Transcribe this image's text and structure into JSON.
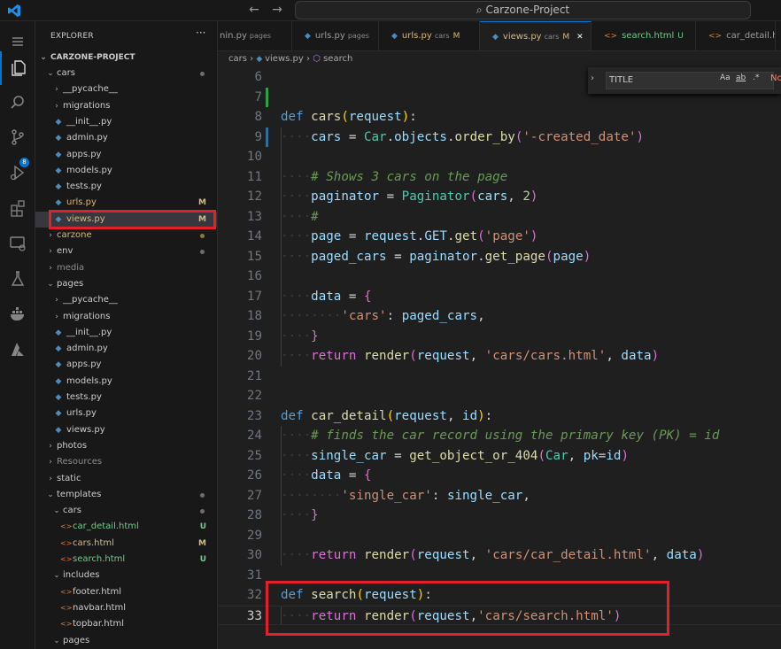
{
  "window": {
    "search_text": "Carzone-Project"
  },
  "explorer": {
    "title": "EXPLORER",
    "project": "CARZONE-PROJECT",
    "items": [
      {
        "label": "cars",
        "type": "folder",
        "open": true,
        "depth": 1,
        "dot": true
      },
      {
        "label": "__pycache__",
        "type": "folder",
        "open": false,
        "depth": 2
      },
      {
        "label": "migrations",
        "type": "folder",
        "open": false,
        "depth": 2
      },
      {
        "label": "__init__.py",
        "type": "py",
        "depth": 2
      },
      {
        "label": "admin.py",
        "type": "py",
        "depth": 2
      },
      {
        "label": "apps.py",
        "type": "py",
        "depth": 2
      },
      {
        "label": "models.py",
        "type": "py",
        "depth": 2
      },
      {
        "label": "tests.py",
        "type": "py",
        "depth": 2
      },
      {
        "label": "urls.py",
        "type": "py",
        "depth": 2,
        "status": "M"
      },
      {
        "label": "views.py",
        "type": "py",
        "depth": 2,
        "status": "M",
        "selected": true
      },
      {
        "label": "carzone",
        "type": "folder",
        "open": false,
        "depth": 1,
        "dot": true,
        "color": "mod"
      },
      {
        "label": "env",
        "type": "folder",
        "open": false,
        "depth": 1,
        "dot": true
      },
      {
        "label": "media",
        "type": "folder",
        "open": false,
        "depth": 1,
        "color": "dim"
      },
      {
        "label": "pages",
        "type": "folder",
        "open": true,
        "depth": 1
      },
      {
        "label": "__pycache__",
        "type": "folder",
        "open": false,
        "depth": 2
      },
      {
        "label": "migrations",
        "type": "folder",
        "open": false,
        "depth": 2
      },
      {
        "label": "__init__.py",
        "type": "py",
        "depth": 2
      },
      {
        "label": "admin.py",
        "type": "py",
        "depth": 2
      },
      {
        "label": "apps.py",
        "type": "py",
        "depth": 2
      },
      {
        "label": "models.py",
        "type": "py",
        "depth": 2
      },
      {
        "label": "tests.py",
        "type": "py",
        "depth": 2
      },
      {
        "label": "urls.py",
        "type": "py",
        "depth": 2
      },
      {
        "label": "views.py",
        "type": "py",
        "depth": 2
      },
      {
        "label": "photos",
        "type": "folder",
        "open": false,
        "depth": 1
      },
      {
        "label": "Resources",
        "type": "folder",
        "open": false,
        "depth": 1,
        "color": "dim"
      },
      {
        "label": "static",
        "type": "folder",
        "open": false,
        "depth": 1
      },
      {
        "label": "templates",
        "type": "folder",
        "open": true,
        "depth": 1,
        "dot": true
      },
      {
        "label": "cars",
        "type": "folder",
        "open": true,
        "depth": 2,
        "dot": true
      },
      {
        "label": "car_detail.html",
        "type": "html",
        "depth": 3,
        "status": "U"
      },
      {
        "label": "cars.html",
        "type": "html",
        "depth": 3,
        "status": "M"
      },
      {
        "label": "search.html",
        "type": "html",
        "depth": 3,
        "status": "U"
      },
      {
        "label": "includes",
        "type": "folder",
        "open": true,
        "depth": 2
      },
      {
        "label": "footer.html",
        "type": "html",
        "depth": 3
      },
      {
        "label": "navbar.html",
        "type": "html",
        "depth": 3
      },
      {
        "label": "topbar.html",
        "type": "html",
        "depth": 3
      },
      {
        "label": "pages",
        "type": "folder",
        "open": true,
        "depth": 2
      }
    ]
  },
  "tabs": [
    {
      "name": "nin.py",
      "desc": "pages",
      "type": "py"
    },
    {
      "name": "urls.py",
      "desc": "pages",
      "type": "py"
    },
    {
      "name": "urls.py",
      "desc": "cars",
      "status": "M",
      "type": "py"
    },
    {
      "name": "views.py",
      "desc": "cars",
      "status": "M",
      "type": "py",
      "active": true
    },
    {
      "name": "search.html",
      "status": "U",
      "type": "html"
    },
    {
      "name": "car_detail.h",
      "type": "html"
    }
  ],
  "breadcrumb": [
    "cars",
    "views.py",
    "search"
  ],
  "find": {
    "value": "TITLE",
    "opt1": "Aa",
    "opt2": "ab",
    "opt3": ".*",
    "result": "No"
  },
  "code": [
    {
      "n": "6",
      "t": []
    },
    {
      "n": "7",
      "t": []
    },
    {
      "n": "8",
      "t": [
        [
          "kw",
          "def "
        ],
        [
          "fn",
          "cars"
        ],
        [
          "br1",
          "("
        ],
        [
          "par",
          "request"
        ],
        [
          "br1",
          ")"
        ],
        [
          "op",
          ":"
        ]
      ]
    },
    {
      "n": "9",
      "t": [
        [
          "ws",
          "····"
        ],
        [
          "par",
          "cars"
        ],
        [
          "op",
          " = "
        ],
        [
          "cls",
          "Car"
        ],
        [
          "op",
          "."
        ],
        [
          "par",
          "objects"
        ],
        [
          "op",
          "."
        ],
        [
          "fn",
          "order_by"
        ],
        [
          "br2",
          "("
        ],
        [
          "str",
          "'-created_date'"
        ],
        [
          "br2",
          ")"
        ]
      ]
    },
    {
      "n": "10",
      "t": []
    },
    {
      "n": "11",
      "t": [
        [
          "ws",
          "····"
        ],
        [
          "cm",
          "# Shows 3 cars on the page"
        ]
      ]
    },
    {
      "n": "12",
      "t": [
        [
          "ws",
          "····"
        ],
        [
          "par",
          "paginator"
        ],
        [
          "op",
          " = "
        ],
        [
          "cls",
          "Paginator"
        ],
        [
          "br2",
          "("
        ],
        [
          "par",
          "cars"
        ],
        [
          "op",
          ", "
        ],
        [
          "num",
          "2"
        ],
        [
          "br2",
          ")"
        ]
      ]
    },
    {
      "n": "13",
      "t": [
        [
          "ws",
          "····"
        ],
        [
          "cm",
          "#"
        ]
      ]
    },
    {
      "n": "14",
      "t": [
        [
          "ws",
          "····"
        ],
        [
          "par",
          "page"
        ],
        [
          "op",
          " = "
        ],
        [
          "par",
          "request"
        ],
        [
          "op",
          "."
        ],
        [
          "par",
          "GET"
        ],
        [
          "op",
          "."
        ],
        [
          "fn",
          "get"
        ],
        [
          "br2",
          "("
        ],
        [
          "str",
          "'page'"
        ],
        [
          "br2",
          ")"
        ]
      ]
    },
    {
      "n": "15",
      "t": [
        [
          "ws",
          "····"
        ],
        [
          "par",
          "paged_cars"
        ],
        [
          "op",
          " = "
        ],
        [
          "par",
          "paginator"
        ],
        [
          "op",
          "."
        ],
        [
          "fn",
          "get_page"
        ],
        [
          "br2",
          "("
        ],
        [
          "par",
          "page"
        ],
        [
          "br2",
          ")"
        ]
      ]
    },
    {
      "n": "16",
      "t": []
    },
    {
      "n": "17",
      "t": [
        [
          "ws",
          "····"
        ],
        [
          "par",
          "data"
        ],
        [
          "op",
          " = "
        ],
        [
          "br2",
          "{"
        ]
      ]
    },
    {
      "n": "18",
      "t": [
        [
          "ws",
          "········"
        ],
        [
          "str",
          "'cars'"
        ],
        [
          "op",
          ": "
        ],
        [
          "par",
          "paged_cars"
        ],
        [
          "op",
          ","
        ]
      ]
    },
    {
      "n": "19",
      "t": [
        [
          "ws",
          "····"
        ],
        [
          "br2",
          "}"
        ]
      ]
    },
    {
      "n": "20",
      "t": [
        [
          "ws",
          "····"
        ],
        [
          "br2",
          "return "
        ],
        [
          "fn",
          "render"
        ],
        [
          "br2",
          "("
        ],
        [
          "par",
          "request"
        ],
        [
          "op",
          ", "
        ],
        [
          "str",
          "'cars/cars.html'"
        ],
        [
          "op",
          ", "
        ],
        [
          "par",
          "data"
        ],
        [
          "br2",
          ")"
        ]
      ]
    },
    {
      "n": "21",
      "t": []
    },
    {
      "n": "22",
      "t": []
    },
    {
      "n": "23",
      "t": [
        [
          "kw",
          "def "
        ],
        [
          "fn",
          "car_detail"
        ],
        [
          "br1",
          "("
        ],
        [
          "par",
          "request"
        ],
        [
          "op",
          ", "
        ],
        [
          "par",
          "id"
        ],
        [
          "br1",
          ")"
        ],
        [
          "op",
          ":"
        ]
      ]
    },
    {
      "n": "24",
      "t": [
        [
          "ws",
          "····"
        ],
        [
          "cm",
          "# finds the car record using the primary key (PK) = id"
        ]
      ]
    },
    {
      "n": "25",
      "t": [
        [
          "ws",
          "····"
        ],
        [
          "par",
          "single_car"
        ],
        [
          "op",
          " = "
        ],
        [
          "fn",
          "get_object_or_404"
        ],
        [
          "br2",
          "("
        ],
        [
          "cls",
          "Car"
        ],
        [
          "op",
          ", "
        ],
        [
          "par",
          "pk"
        ],
        [
          "op",
          "="
        ],
        [
          "par",
          "id"
        ],
        [
          "br2",
          ")"
        ]
      ]
    },
    {
      "n": "26",
      "t": [
        [
          "ws",
          "····"
        ],
        [
          "par",
          "data"
        ],
        [
          "op",
          " = "
        ],
        [
          "br2",
          "{"
        ]
      ]
    },
    {
      "n": "27",
      "t": [
        [
          "ws",
          "········"
        ],
        [
          "str",
          "'single_car'"
        ],
        [
          "op",
          ": "
        ],
        [
          "par",
          "single_car"
        ],
        [
          "op",
          ","
        ]
      ]
    },
    {
      "n": "28",
      "t": [
        [
          "ws",
          "····"
        ],
        [
          "br2",
          "}"
        ]
      ]
    },
    {
      "n": "29",
      "t": []
    },
    {
      "n": "30",
      "t": [
        [
          "ws",
          "····"
        ],
        [
          "br2",
          "return "
        ],
        [
          "fn",
          "render"
        ],
        [
          "br2",
          "("
        ],
        [
          "par",
          "request"
        ],
        [
          "op",
          ", "
        ],
        [
          "str",
          "'cars/car_detail.html'"
        ],
        [
          "op",
          ", "
        ],
        [
          "par",
          "data"
        ],
        [
          "br2",
          ")"
        ]
      ]
    },
    {
      "n": "31",
      "t": []
    },
    {
      "n": "32",
      "t": [
        [
          "kw",
          "def "
        ],
        [
          "fn",
          "search"
        ],
        [
          "br1",
          "("
        ],
        [
          "par",
          "request"
        ],
        [
          "br1",
          ")"
        ],
        [
          "op",
          ":"
        ]
      ]
    },
    {
      "n": "33",
      "t": [
        [
          "ws",
          "····"
        ],
        [
          "br2",
          "return "
        ],
        [
          "fn",
          "render"
        ],
        [
          "br2",
          "("
        ],
        [
          "par",
          "request"
        ],
        [
          "op",
          ","
        ],
        [
          "str",
          "'cars/search.html'"
        ],
        [
          "br2",
          ")"
        ]
      ],
      "current": true
    }
  ]
}
